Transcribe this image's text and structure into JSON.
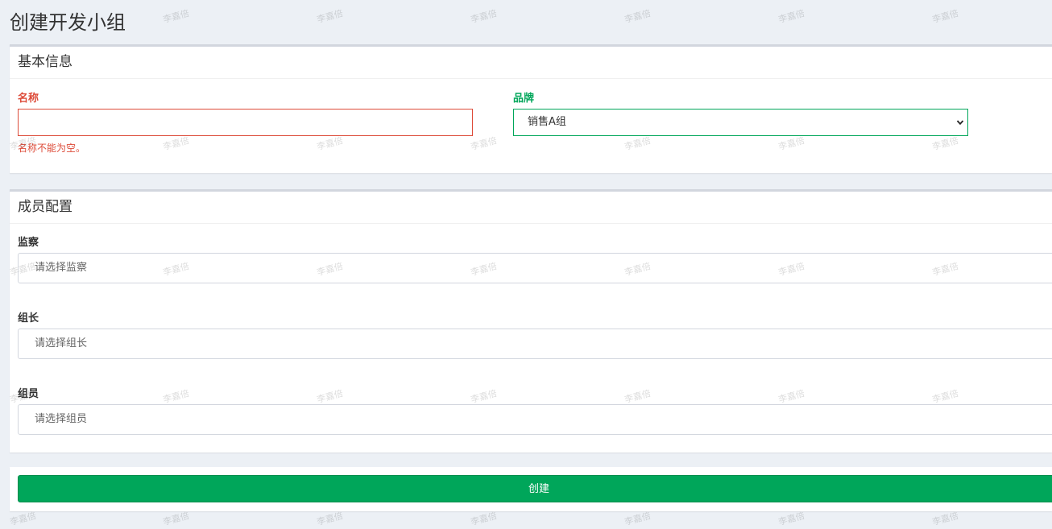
{
  "page": {
    "title": "创建开发小组"
  },
  "basic_info": {
    "title": "基本信息",
    "name": {
      "label": "名称",
      "value": "",
      "error": "名称不能为空。"
    },
    "brand": {
      "label": "品牌",
      "selected": "销售A组"
    }
  },
  "members": {
    "title": "成员配置",
    "supervisor": {
      "label": "监察",
      "placeholder": "请选择监察"
    },
    "leader": {
      "label": "组长",
      "placeholder": "请选择组长"
    },
    "member": {
      "label": "组员",
      "placeholder": "请选择组员"
    }
  },
  "actions": {
    "create_label": "创建"
  },
  "watermark": {
    "text": "李嘉倍"
  },
  "colors": {
    "error": "#dd4b39",
    "success": "#00a65a",
    "background": "#ecf0f5"
  },
  "icons": {
    "select_arrow": "chevron-down-icon"
  }
}
